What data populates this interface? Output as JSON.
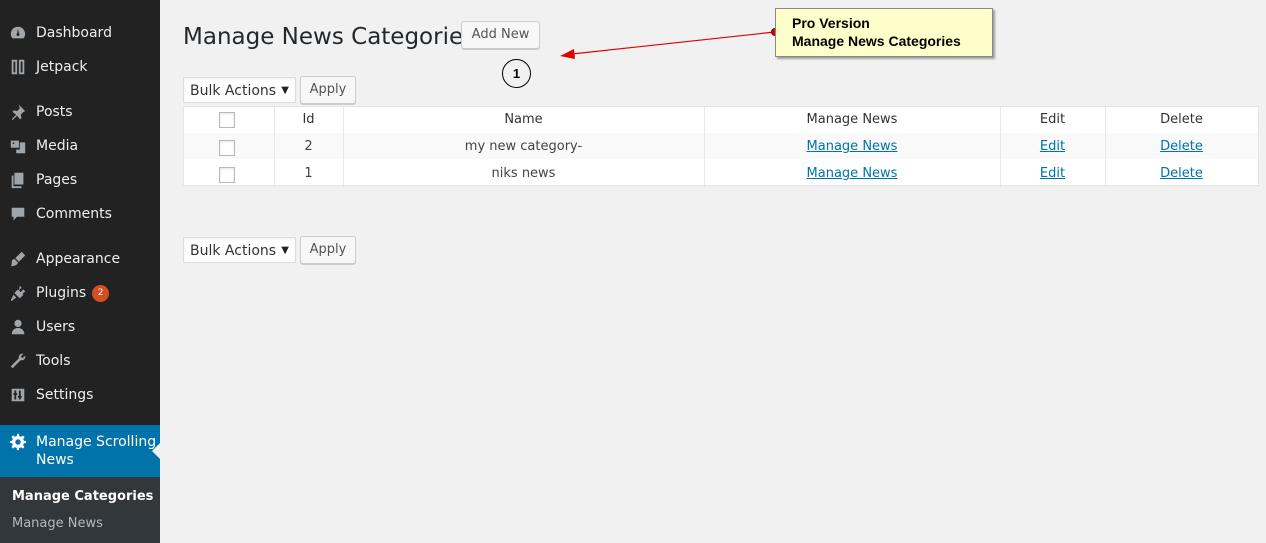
{
  "sidebar": {
    "items": [
      {
        "label": "Dashboard",
        "icon": "dashboard-icon"
      },
      {
        "label": "Jetpack",
        "icon": "jetpack-icon"
      },
      {
        "label": "Posts",
        "icon": "pin-icon"
      },
      {
        "label": "Media",
        "icon": "media-icon"
      },
      {
        "label": "Pages",
        "icon": "pages-icon"
      },
      {
        "label": "Comments",
        "icon": "comment-icon"
      },
      {
        "label": "Appearance",
        "icon": "brush-icon"
      },
      {
        "label": "Plugins",
        "icon": "plugin-icon",
        "badge": "2"
      },
      {
        "label": "Users",
        "icon": "user-icon"
      },
      {
        "label": "Tools",
        "icon": "wrench-icon"
      },
      {
        "label": "Settings",
        "icon": "settings-icon"
      }
    ],
    "active": {
      "label": "Manage Scrolling News",
      "icon": "gear-icon"
    },
    "submenu": [
      {
        "label": "Manage Categories",
        "current": true
      },
      {
        "label": "Manage News",
        "current": false
      }
    ]
  },
  "main": {
    "title": "Manage News Categories",
    "add_new_label": "Add New",
    "bulk_top": {
      "selected": "Bulk Actions",
      "apply_label": "Apply"
    },
    "bulk_bottom": {
      "selected": "Bulk Actions",
      "apply_label": "Apply"
    },
    "table": {
      "headers": {
        "id": "Id",
        "name": "Name",
        "manage": "Manage News",
        "edit": "Edit",
        "delete": "Delete"
      },
      "rows": [
        {
          "id": "2",
          "name": "my new category-",
          "manage": "Manage News",
          "edit": "Edit",
          "delete": "Delete"
        },
        {
          "id": "1",
          "name": "niks news",
          "manage": "Manage News",
          "edit": "Edit",
          "delete": "Delete"
        }
      ]
    }
  },
  "annotation": {
    "line1": "Pro Version",
    "line2": "Manage News Categories",
    "marker": "1"
  },
  "colors": {
    "sidebar_bg": "#222222",
    "active_bg": "#0073aa",
    "link": "#0073aa",
    "badge": "#d54e21",
    "note_bg": "#ffffcc",
    "arrow": "#e00000"
  }
}
